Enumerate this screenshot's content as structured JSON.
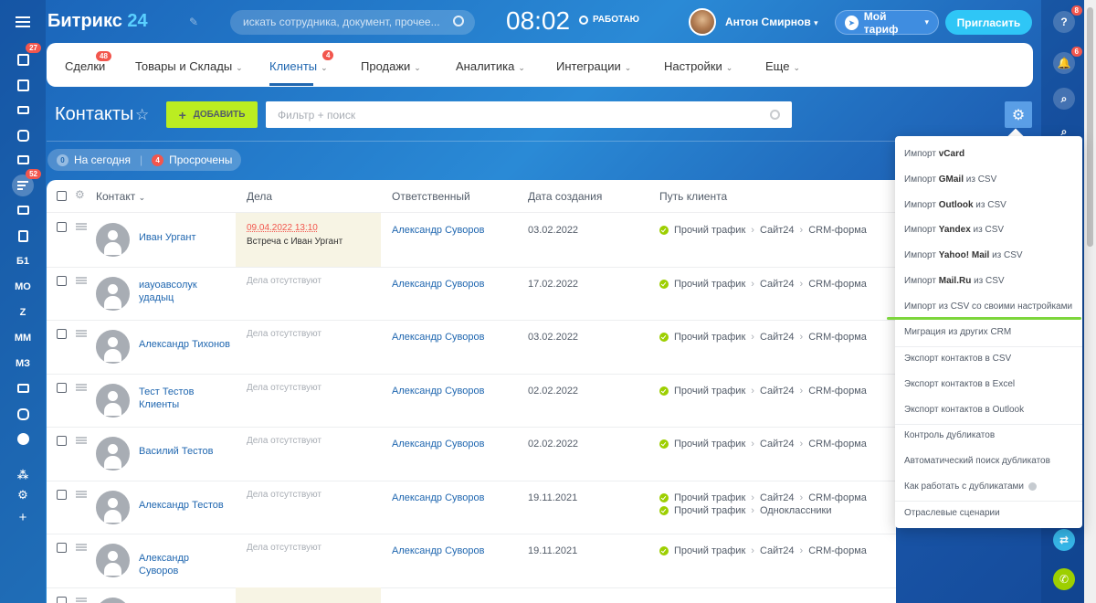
{
  "header": {
    "logo_main": "Битрикс",
    "logo_num": "24",
    "search_placeholder": "искать сотрудника, документ, прочее...",
    "clock": "08:02",
    "work_status": "РАБОТАЮ",
    "user_name": "Антон Смирнов",
    "tariff_label": "Мой тариф",
    "invite_label": "Пригласить"
  },
  "left_rail": {
    "badges": {
      "tasks": "27",
      "feed": "52"
    },
    "labels": [
      "Б1",
      "МО",
      "Z",
      "ММ",
      "МЗ"
    ]
  },
  "right_rail": {
    "badges": {
      "help": "8",
      "notifications": "6"
    }
  },
  "nav": {
    "items": [
      {
        "label": "Сделки",
        "badge": "48"
      },
      {
        "label": "Товары и Склады"
      },
      {
        "label": "Клиенты",
        "badge": "4"
      },
      {
        "label": "Продажи"
      },
      {
        "label": "Аналитика"
      },
      {
        "label": "Интеграции"
      },
      {
        "label": "Настройки"
      },
      {
        "label": "Еще"
      }
    ]
  },
  "page": {
    "title": "Контакты",
    "add_label": "ДОБАВИТЬ",
    "filter_placeholder": "Фильтр + поиск",
    "counter_today": {
      "count": "0",
      "label": "На сегодня"
    },
    "counter_overdue": {
      "count": "4",
      "label": "Просрочены"
    }
  },
  "table": {
    "headers": [
      "Контакт",
      "Дела",
      "Ответственный",
      "Дата создания",
      "Путь клиента"
    ],
    "rows": [
      {
        "name": "Иван Ургант",
        "deal_date": "09.04.2022 13:10",
        "deal_text": "Встреча с Иван Ургант",
        "resp": "Александр Суворов",
        "created": "03.02.2022",
        "path": [
          "Прочий трафик",
          "Сайт24",
          "CRM-форма"
        ]
      },
      {
        "name": "иауоавсолук удадыц",
        "deals": "Дела отсутствуют",
        "resp": "Александр Суворов",
        "created": "17.02.2022",
        "path": [
          "Прочий трафик",
          "Сайт24",
          "CRM-форма"
        ]
      },
      {
        "name": "Александр Тихонов",
        "deals": "Дела отсутствуют",
        "resp": "Александр Суворов",
        "created": "03.02.2022",
        "path": [
          "Прочий трафик",
          "Сайт24",
          "CRM-форма"
        ]
      },
      {
        "name": "Тест Тестов Клиенты",
        "deals": "Дела отсутствуют",
        "resp": "Александр Суворов",
        "created": "02.02.2022",
        "path": [
          "Прочий трафик",
          "Сайт24",
          "CRM-форма"
        ]
      },
      {
        "name": "Василий Тестов",
        "deals": "Дела отсутствуют",
        "resp": "Александр Суворов",
        "created": "02.02.2022",
        "path": [
          "Прочий трафик",
          "Сайт24",
          "CRM-форма"
        ]
      },
      {
        "name": "Александр Тестов",
        "deals": "Дела отсутствуют",
        "resp": "Александр Суворов",
        "created": "19.11.2021",
        "path": [
          "Прочий трафик",
          "Сайт24",
          "CRM-форма"
        ],
        "path2": [
          "Прочий трафик",
          "Одноклассники"
        ]
      },
      {
        "name": "Александр Суворов",
        "deals": "Дела отсутствуют",
        "resp": "Александр Суворов",
        "created": "19.11.2021",
        "path": [
          "Прочий трафик",
          "Сайт24",
          "CRM-форма"
        ]
      }
    ]
  },
  "menu": {
    "items": [
      {
        "pre": "Импорт ",
        "bold": "vCard",
        "post": ""
      },
      {
        "pre": "Импорт ",
        "bold": "GMail",
        "post": " из CSV"
      },
      {
        "pre": "Импорт ",
        "bold": "Outlook",
        "post": " из CSV"
      },
      {
        "pre": "Импорт ",
        "bold": "Yandex",
        "post": " из CSV"
      },
      {
        "pre": "Импорт ",
        "bold": "Yahoo! Mail",
        "post": " из CSV"
      },
      {
        "pre": "Импорт ",
        "bold": "Mail.Ru",
        "post": " из CSV"
      },
      {
        "pre": "Импорт из CSV со своими настройками",
        "bold": "",
        "post": ""
      },
      {
        "pre": "Миграция из других CRM",
        "bold": "",
        "post": ""
      },
      {
        "pre": "Экспорт контактов в CSV",
        "bold": "",
        "post": ""
      },
      {
        "pre": "Экспорт контактов в Excel",
        "bold": "",
        "post": ""
      },
      {
        "pre": "Экспорт контактов в Outlook",
        "bold": "",
        "post": ""
      },
      {
        "pre": "Контроль дубликатов",
        "bold": "",
        "post": ""
      },
      {
        "pre": "Автоматический поиск дубликатов",
        "bold": "",
        "post": ""
      },
      {
        "pre": "Как работать с дубликатами",
        "bold": "",
        "post": ""
      },
      {
        "pre": "Отраслевые сценарии",
        "bold": "",
        "post": ""
      }
    ]
  },
  "colors": {
    "accent": "#2067b0",
    "add_button": "#bbed21",
    "highlight": "#7dd63c",
    "badge": "#f2564d"
  }
}
